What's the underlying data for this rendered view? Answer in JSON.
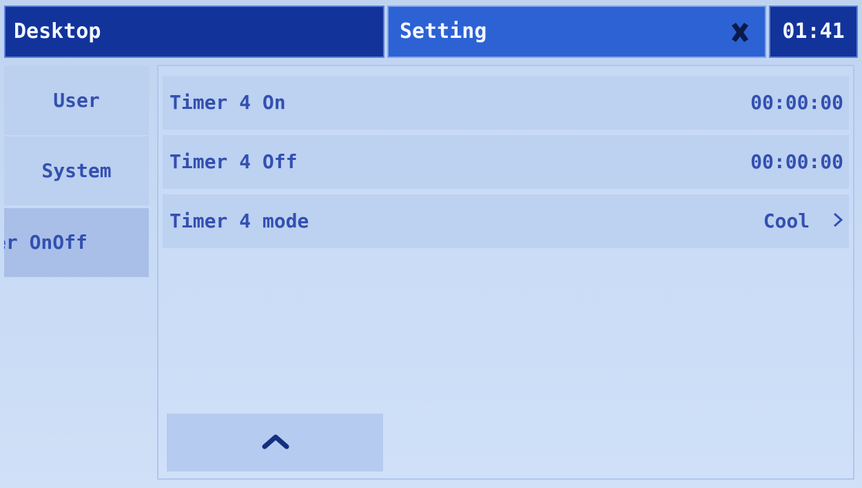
{
  "header": {
    "left_tab_label": "Desktop",
    "title": "Setting",
    "close_icon": "close-icon",
    "clock": "01:41"
  },
  "sidebar": {
    "items": [
      {
        "label": "User"
      },
      {
        "label": "System"
      },
      {
        "label": "er OnOff",
        "selected": true
      }
    ]
  },
  "settings": {
    "rows": [
      {
        "label": "Timer 4 On",
        "value": "00:00:00"
      },
      {
        "label": "Timer 4 Off",
        "value": "00:00:00"
      },
      {
        "label": "Timer 4 mode",
        "value": "Cool",
        "icon": "chevron-right-icon"
      }
    ]
  },
  "controls": {
    "scroll_up_icon": "chevron-up-icon"
  },
  "colors": {
    "header_dark": "#12339a",
    "header_active": "#2d62d4",
    "text": "#3350b0",
    "background": "#c7daf4"
  }
}
